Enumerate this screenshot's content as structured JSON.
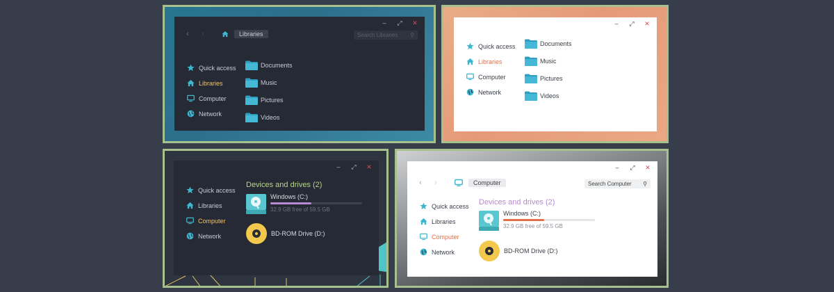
{
  "screens": [
    {
      "theme": "dark",
      "breadcrumb": "Libraries",
      "search_placeholder": "Search Libraries",
      "sidebar": [
        {
          "label": "Quick access",
          "icon": "star-icon"
        },
        {
          "label": "Libraries",
          "icon": "home-icon",
          "active": true
        },
        {
          "label": "Computer",
          "icon": "monitor-icon"
        },
        {
          "label": "Network",
          "icon": "globe-icon"
        }
      ],
      "folders": [
        "Documents",
        "Music",
        "Pictures",
        "Videos"
      ]
    },
    {
      "theme": "light",
      "sidebar": [
        {
          "label": "Quick access",
          "icon": "star-icon"
        },
        {
          "label": "Libraries",
          "icon": "home-icon",
          "active": true
        },
        {
          "label": "Computer",
          "icon": "monitor-icon"
        },
        {
          "label": "Network",
          "icon": "globe-icon"
        }
      ],
      "folders": [
        "Documents",
        "Music",
        "Pictures",
        "Videos"
      ]
    },
    {
      "theme": "dark",
      "sidebar": [
        {
          "label": "Quick access",
          "icon": "star-icon"
        },
        {
          "label": "Libraries",
          "icon": "home-icon"
        },
        {
          "label": "Computer",
          "icon": "monitor-icon",
          "active": true
        },
        {
          "label": "Network",
          "icon": "globe-icon"
        }
      ],
      "section_title": "Devices and drives (2)",
      "drives": [
        {
          "name": "Windows (C:)",
          "free": "32.9 GB free of 59.5 GB",
          "used_fraction": 0.45
        },
        {
          "name": "BD-ROM Drive (D:)"
        }
      ]
    },
    {
      "theme": "light",
      "breadcrumb": "Computer",
      "search_placeholder": "Search Computer",
      "sidebar": [
        {
          "label": "Quick access",
          "icon": "star-icon"
        },
        {
          "label": "Libraries",
          "icon": "home-icon"
        },
        {
          "label": "Computer",
          "icon": "monitor-icon",
          "active": true
        },
        {
          "label": "Network",
          "icon": "globe-icon"
        }
      ],
      "section_title": "Devices and drives (2)",
      "drives": [
        {
          "name": "Windows (C:)",
          "free": "32.9 GB free of 59.5 GB",
          "used_fraction": 0.45
        },
        {
          "name": "BD-ROM Drive (D:)"
        }
      ]
    }
  ],
  "window_controls": {
    "minimize": "–",
    "maximize": "⤢",
    "close": "✕"
  },
  "colors": {
    "accent_teal": "#3fb6cf",
    "accent_yellow": "#f2c26a",
    "accent_orange": "#e0704a",
    "accent_purple": "#b78ad1",
    "close_red": "#d8485a",
    "border_green": "#a6c08e",
    "dark_window": "#262a35"
  }
}
